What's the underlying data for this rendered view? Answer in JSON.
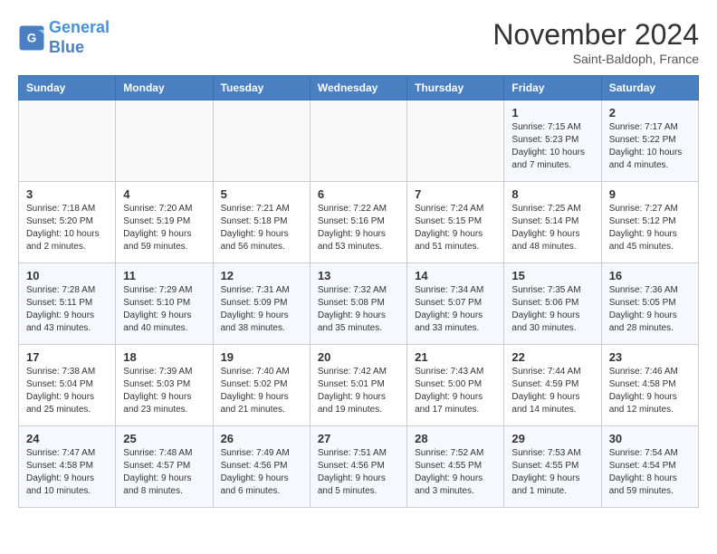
{
  "header": {
    "logo_line1": "General",
    "logo_line2": "Blue",
    "month_title": "November 2024",
    "location": "Saint-Baldoph, France"
  },
  "weekdays": [
    "Sunday",
    "Monday",
    "Tuesday",
    "Wednesday",
    "Thursday",
    "Friday",
    "Saturday"
  ],
  "weeks": [
    [
      {
        "day": "",
        "info": ""
      },
      {
        "day": "",
        "info": ""
      },
      {
        "day": "",
        "info": ""
      },
      {
        "day": "",
        "info": ""
      },
      {
        "day": "",
        "info": ""
      },
      {
        "day": "1",
        "info": "Sunrise: 7:15 AM\nSunset: 5:23 PM\nDaylight: 10 hours and 7 minutes."
      },
      {
        "day": "2",
        "info": "Sunrise: 7:17 AM\nSunset: 5:22 PM\nDaylight: 10 hours and 4 minutes."
      }
    ],
    [
      {
        "day": "3",
        "info": "Sunrise: 7:18 AM\nSunset: 5:20 PM\nDaylight: 10 hours and 2 minutes."
      },
      {
        "day": "4",
        "info": "Sunrise: 7:20 AM\nSunset: 5:19 PM\nDaylight: 9 hours and 59 minutes."
      },
      {
        "day": "5",
        "info": "Sunrise: 7:21 AM\nSunset: 5:18 PM\nDaylight: 9 hours and 56 minutes."
      },
      {
        "day": "6",
        "info": "Sunrise: 7:22 AM\nSunset: 5:16 PM\nDaylight: 9 hours and 53 minutes."
      },
      {
        "day": "7",
        "info": "Sunrise: 7:24 AM\nSunset: 5:15 PM\nDaylight: 9 hours and 51 minutes."
      },
      {
        "day": "8",
        "info": "Sunrise: 7:25 AM\nSunset: 5:14 PM\nDaylight: 9 hours and 48 minutes."
      },
      {
        "day": "9",
        "info": "Sunrise: 7:27 AM\nSunset: 5:12 PM\nDaylight: 9 hours and 45 minutes."
      }
    ],
    [
      {
        "day": "10",
        "info": "Sunrise: 7:28 AM\nSunset: 5:11 PM\nDaylight: 9 hours and 43 minutes."
      },
      {
        "day": "11",
        "info": "Sunrise: 7:29 AM\nSunset: 5:10 PM\nDaylight: 9 hours and 40 minutes."
      },
      {
        "day": "12",
        "info": "Sunrise: 7:31 AM\nSunset: 5:09 PM\nDaylight: 9 hours and 38 minutes."
      },
      {
        "day": "13",
        "info": "Sunrise: 7:32 AM\nSunset: 5:08 PM\nDaylight: 9 hours and 35 minutes."
      },
      {
        "day": "14",
        "info": "Sunrise: 7:34 AM\nSunset: 5:07 PM\nDaylight: 9 hours and 33 minutes."
      },
      {
        "day": "15",
        "info": "Sunrise: 7:35 AM\nSunset: 5:06 PM\nDaylight: 9 hours and 30 minutes."
      },
      {
        "day": "16",
        "info": "Sunrise: 7:36 AM\nSunset: 5:05 PM\nDaylight: 9 hours and 28 minutes."
      }
    ],
    [
      {
        "day": "17",
        "info": "Sunrise: 7:38 AM\nSunset: 5:04 PM\nDaylight: 9 hours and 25 minutes."
      },
      {
        "day": "18",
        "info": "Sunrise: 7:39 AM\nSunset: 5:03 PM\nDaylight: 9 hours and 23 minutes."
      },
      {
        "day": "19",
        "info": "Sunrise: 7:40 AM\nSunset: 5:02 PM\nDaylight: 9 hours and 21 minutes."
      },
      {
        "day": "20",
        "info": "Sunrise: 7:42 AM\nSunset: 5:01 PM\nDaylight: 9 hours and 19 minutes."
      },
      {
        "day": "21",
        "info": "Sunrise: 7:43 AM\nSunset: 5:00 PM\nDaylight: 9 hours and 17 minutes."
      },
      {
        "day": "22",
        "info": "Sunrise: 7:44 AM\nSunset: 4:59 PM\nDaylight: 9 hours and 14 minutes."
      },
      {
        "day": "23",
        "info": "Sunrise: 7:46 AM\nSunset: 4:58 PM\nDaylight: 9 hours and 12 minutes."
      }
    ],
    [
      {
        "day": "24",
        "info": "Sunrise: 7:47 AM\nSunset: 4:58 PM\nDaylight: 9 hours and 10 minutes."
      },
      {
        "day": "25",
        "info": "Sunrise: 7:48 AM\nSunset: 4:57 PM\nDaylight: 9 hours and 8 minutes."
      },
      {
        "day": "26",
        "info": "Sunrise: 7:49 AM\nSunset: 4:56 PM\nDaylight: 9 hours and 6 minutes."
      },
      {
        "day": "27",
        "info": "Sunrise: 7:51 AM\nSunset: 4:56 PM\nDaylight: 9 hours and 5 minutes."
      },
      {
        "day": "28",
        "info": "Sunrise: 7:52 AM\nSunset: 4:55 PM\nDaylight: 9 hours and 3 minutes."
      },
      {
        "day": "29",
        "info": "Sunrise: 7:53 AM\nSunset: 4:55 PM\nDaylight: 9 hours and 1 minute."
      },
      {
        "day": "30",
        "info": "Sunrise: 7:54 AM\nSunset: 4:54 PM\nDaylight: 8 hours and 59 minutes."
      }
    ]
  ]
}
